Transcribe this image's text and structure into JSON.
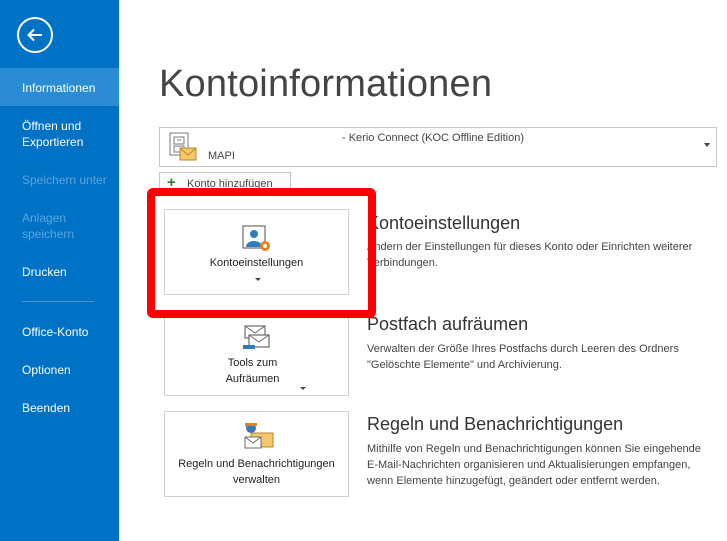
{
  "sidebar": {
    "items": [
      {
        "label": "Informationen",
        "active": true,
        "disabled": false
      },
      {
        "label": "Öffnen und Exportieren",
        "active": false,
        "disabled": false
      },
      {
        "label": "Speichern unter",
        "active": false,
        "disabled": true
      },
      {
        "label": "Anlagen speichern",
        "active": false,
        "disabled": true
      },
      {
        "label": "Drucken",
        "active": false,
        "disabled": false
      },
      {
        "label": "Office-Konto",
        "active": false,
        "disabled": false
      },
      {
        "label": "Optionen",
        "active": false,
        "disabled": false
      },
      {
        "label": "Beenden",
        "active": false,
        "disabled": false
      }
    ]
  },
  "main": {
    "title": "Kontoinformationen",
    "account": {
      "name": "- Kerio Connect (KOC Offline Edition)",
      "type": "MAPI"
    },
    "add_account_label": "Konto hinzufügen",
    "sections": [
      {
        "tile_label": "Kontoeinstellungen",
        "title": "Kontoeinstellungen",
        "description": "Ändern der Einstellungen für dieses Konto oder Einrichten weiterer Verbindungen."
      },
      {
        "tile_label": "Tools zum Aufräumen",
        "title": "Postfach aufräumen",
        "description": "Verwalten der Größe Ihres Postfachs durch Leeren des Ordners \"Gelöschte Elemente\" und Archivierung."
      },
      {
        "tile_label": "Regeln und Benachrichtigungen verwalten",
        "title": "Regeln und Benachrichtigungen",
        "description": "Mithilfe von Regeln und Benachrichtigungen können Sie eingehende E-Mail-Nachrichten organisieren und Aktualisierungen empfangen, wenn Elemente hinzugefügt, geändert oder entfernt werden."
      }
    ]
  },
  "colors": {
    "sidebar_bg": "#0072c6",
    "sidebar_active": "#2a8dd4",
    "highlight": "#ff0000"
  }
}
